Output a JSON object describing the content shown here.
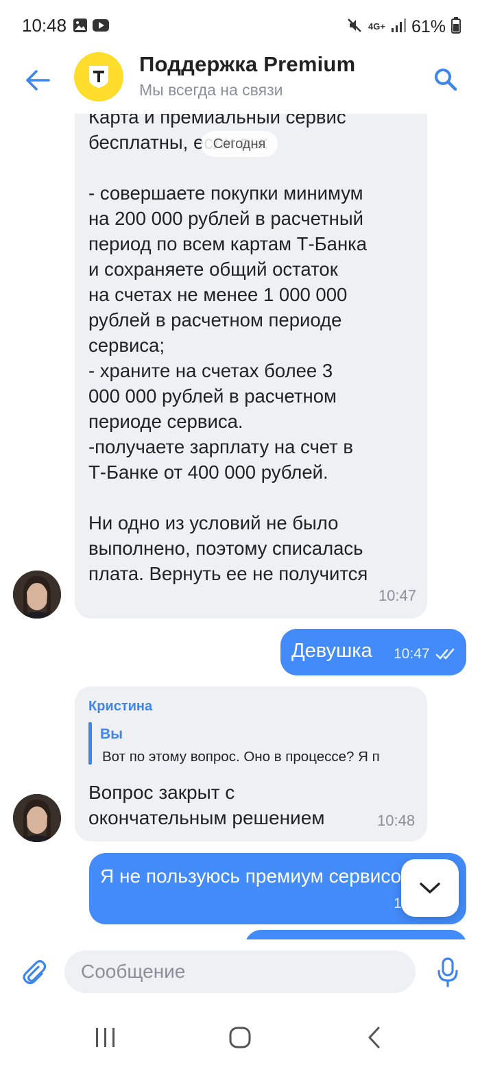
{
  "status_bar": {
    "time": "10:48",
    "network": "4G+",
    "battery": "61%"
  },
  "header": {
    "title": "Поддержка Premium",
    "subtitle": "Мы всегда на связи",
    "logo_letter": "Т",
    "logo_color": "#ffdd2d"
  },
  "chat": {
    "date_chip": "Сегодня",
    "messages": [
      {
        "direction": "incoming",
        "text": "Карта и премиальный сервис\nбесплатны, если вы:\n\n- совершаете покупки минимум\nна 200 000 рублей в расчетный\nпериод по всем картам Т-Банка\nи сохраняете общий остаток\nна счетах не менее 1 000 000\nрублей в расчетном периоде\nсервиса;\n- храните на счетах более 3\n000 000 рублей в расчетном\nпериоде сервиса.\n-получаете зарплату на счет в\nТ-Банке от 400 000 рублей.\n\nНи одно из условий не было\nвыполнено, поэтому списалась\nплата. Вернуть ее не получится",
        "time": "10:47"
      },
      {
        "direction": "outgoing",
        "text": "Девушка",
        "time": "10:47",
        "status": "read"
      },
      {
        "direction": "incoming",
        "sender": "Кристина",
        "reply_to": {
          "name": "Вы",
          "text": "Вот по этому вопрос. Оно в процессе? Я п"
        },
        "text": "Вопрос закрыт с\nокончательным решением",
        "time": "10:48"
      },
      {
        "direction": "outgoing",
        "text": "Я не пользуюсь премиум сервисом",
        "time": "10:48"
      }
    ]
  },
  "input": {
    "placeholder": "Сообщение"
  },
  "colors": {
    "accent": "#428bf9",
    "incoming_bubble": "#eff0f3",
    "link": "#3f86ea"
  },
  "icons": {
    "back": "arrow-left-icon",
    "search": "search-icon",
    "attach": "paperclip-icon",
    "mic": "microphone-icon",
    "scroll": "chevron-down-icon"
  }
}
